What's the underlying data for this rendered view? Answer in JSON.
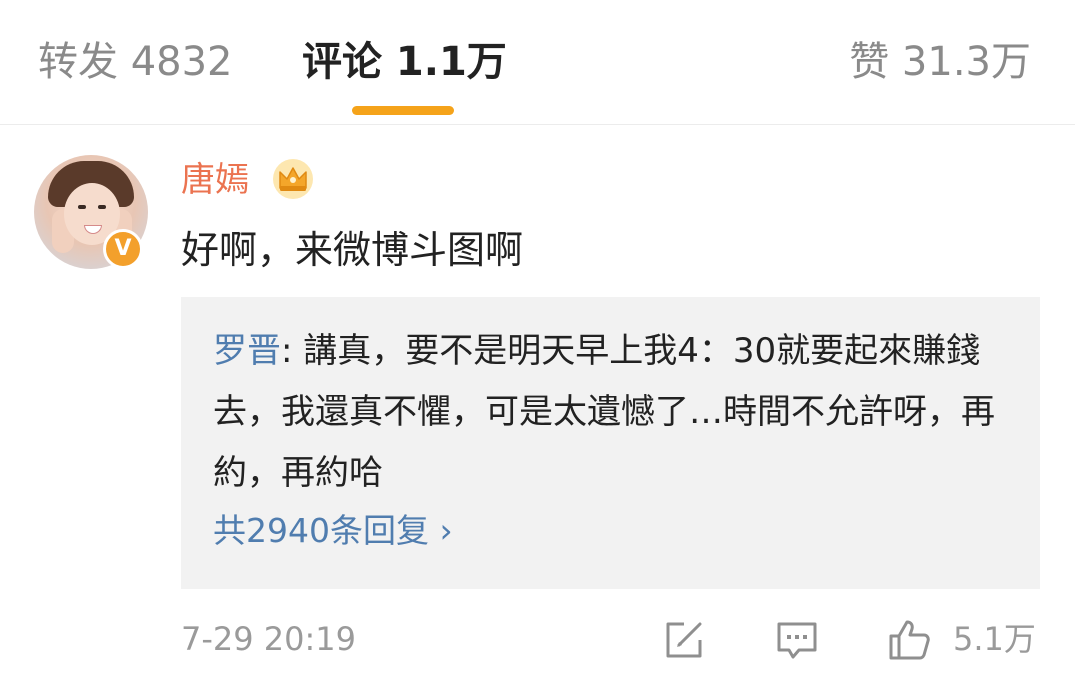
{
  "tabs": {
    "repost": "转发 4832",
    "comments": "评论 1.1万",
    "likes": "赞 31.3万"
  },
  "comment": {
    "username": "唐嫣",
    "text": "好啊，来微博斗图啊",
    "reply": {
      "author": "罗晋",
      "separator": ": ",
      "text": "講真，要不是明天早上我4：30就要起來賺錢去，我還真不懼，可是太遺憾了…時間不允許呀，再約，再約哈",
      "more_replies": "共2940条回复 ›"
    },
    "timestamp": "7-29 20:19",
    "like_count": "5.1万"
  },
  "badge": {
    "verified_glyph": "V"
  },
  "colors": {
    "accent_underline": "#f5a31a",
    "username": "#eb7350",
    "link_blue": "#507daf",
    "verified_badge": "#f3a02c"
  },
  "icons": [
    "crown-icon",
    "verified-badge-icon",
    "edit-icon",
    "comment-icon",
    "like-icon"
  ]
}
